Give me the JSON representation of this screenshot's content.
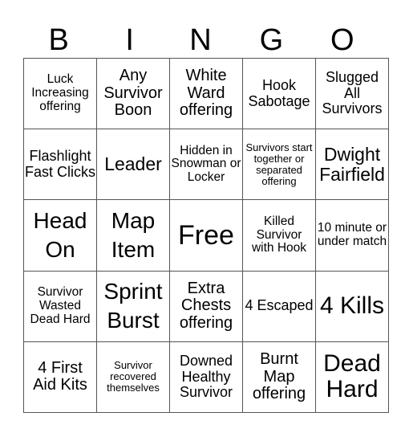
{
  "header": {
    "letters": [
      "B",
      "I",
      "N",
      "G",
      "O"
    ]
  },
  "cells": [
    [
      "Luck Increasing offering",
      "Any Survivor Boon",
      "White Ward offering",
      "Hook Sabotage",
      "Slugged All Survivors"
    ],
    [
      "Flashlight Fast Clicks",
      "Leader",
      "Hidden in Snowman or Locker",
      "Survivors start together or separated offering",
      "Dwight Fairfield"
    ],
    [
      "Head On",
      "Map Item",
      "Free",
      "Killed Survivor with Hook",
      "10 minute or under match"
    ],
    [
      "Survivor Wasted Dead Hard",
      "Sprint Burst",
      "Extra Chests offering",
      "4 Escaped",
      "4 Kills"
    ],
    [
      "4 First Aid Kits",
      "Survivor recovered themselves",
      "Downed Healthy Survivor",
      "Burnt Map offering",
      "Dead Hard"
    ]
  ],
  "colors": {
    "border": "#555555",
    "text": "#000000",
    "background": "#ffffff"
  }
}
